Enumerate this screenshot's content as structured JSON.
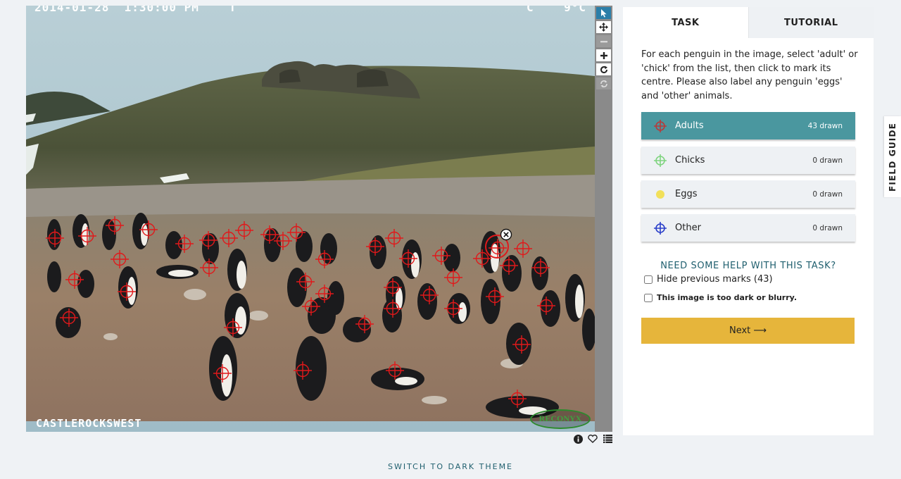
{
  "viewer": {
    "overlay_datetime": "2014-01-28  1:30:00 PM    T",
    "overlay_temp": "C    9°C",
    "location": "CASTLEROCKSWEST",
    "camera_brand": "RECONYX",
    "mark_color": "#e0191b",
    "mark_count": 43
  },
  "toolbar": {
    "tools": [
      "pointer-icon",
      "move-icon",
      "zoom-out-icon",
      "zoom-in-icon",
      "rotate-icon",
      "reset-icon"
    ],
    "active": "pointer-icon",
    "disabled": [
      "zoom-out-icon",
      "reset-icon"
    ]
  },
  "meta_icons": [
    "info-icon",
    "favourite-icon",
    "collections-icon"
  ],
  "panel": {
    "tabs": [
      "TASK",
      "TUTORIAL"
    ],
    "active_tab": "TASK",
    "instructions": "For each penguin in the image, select 'adult' or 'chick' from the list, then click to mark its centre. Please also label any penguin 'eggs' and 'other' animals.",
    "tools": [
      {
        "label": "Adults",
        "count": "43 drawn",
        "color": "#b73a3a",
        "active": true
      },
      {
        "label": "Chicks",
        "count": "0 drawn",
        "color": "#7fd47f",
        "active": false
      },
      {
        "label": "Eggs",
        "count": "0 drawn",
        "color": "#f2e05a",
        "active": false
      },
      {
        "label": "Other",
        "count": "0 drawn",
        "color": "#2a3fc9",
        "active": false
      }
    ],
    "help_link": "NEED SOME HELP WITH THIS TASK?",
    "hide_marks_label": "Hide previous marks (43)",
    "dark_label": "This image is too dark or blurry.",
    "next_label": "Next ⟶",
    "colors": {
      "active_tool": "#4a979f",
      "next_button": "#e6b53b",
      "link": "#1f5f6e"
    }
  },
  "field_guide": "FIELD GUIDE",
  "theme_toggle": "SWITCH TO DARK THEME"
}
